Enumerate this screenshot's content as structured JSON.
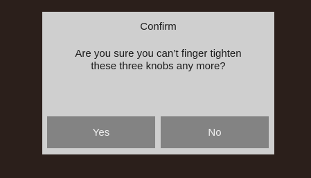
{
  "dialog": {
    "title": "Confirm",
    "message": "Are you sure you can’t finger tighten these three knobs any more?",
    "yes_label": "Yes",
    "no_label": "No"
  },
  "colors": {
    "background": "#2b1f1b",
    "dialog": "#cfcfcf",
    "button": "#838383",
    "button_text": "#f0f0f0",
    "text": "#1a1a1a"
  }
}
